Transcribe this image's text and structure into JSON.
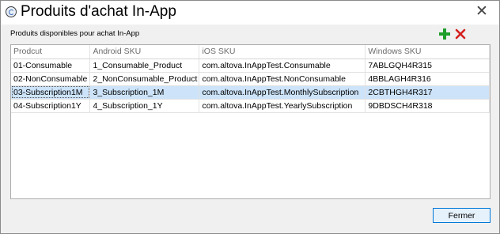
{
  "window": {
    "title": "Produits d'achat In-App",
    "close_glyph": "✕"
  },
  "section_label": "Produits disponibles pour achat In-App",
  "toolbar": {
    "add_icon": "plus-icon",
    "add_color": "#1e9e2a",
    "delete_icon": "x-icon",
    "delete_color": "#d42020"
  },
  "table": {
    "columns": [
      "Prodcut",
      "Android SKU",
      "iOS SKU",
      "Windows SKU"
    ],
    "rows": [
      [
        "01-Consumable",
        "1_Consumable_Product",
        "com.altova.InAppTest.Consumable",
        "7ABLGQH4R315"
      ],
      [
        "02-NonConsumable",
        "2_NonConsumable_Product",
        "com.altova.InAppTest.NonConsumable",
        "4BBLAGH4R316"
      ],
      [
        "03-Subscription1M",
        "3_Subscription_1M",
        "com.altova.InAppTest.MonthlySubscription",
        "2CBTHGH4R317"
      ],
      [
        "04-Subscription1Y",
        "4_Subscription_1Y",
        "com.altova.InAppTest.YearlySubscription",
        "9DBDSCH4R318"
      ]
    ],
    "selected_row": 2,
    "selection_color": "#cce3f9"
  },
  "buttons": {
    "close_label": "Fermer"
  }
}
